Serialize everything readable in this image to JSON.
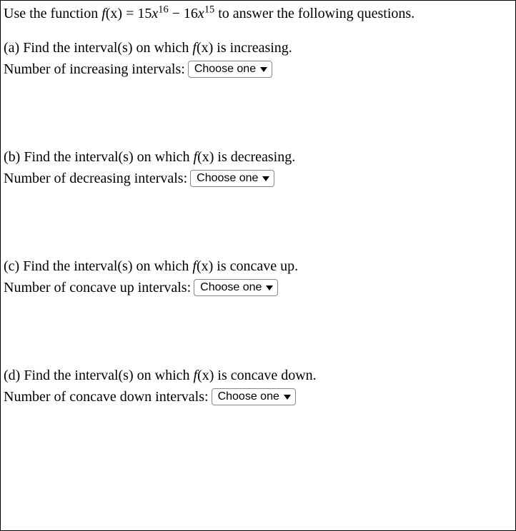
{
  "intro": {
    "prefix": "Use the function ",
    "func_lhs": "f",
    "func_arg": "(x) = 15",
    "var1": "x",
    "exp1": "16",
    "minus": " − 16",
    "var2": "x",
    "exp2": "15",
    "suffix": " to answer the following questions."
  },
  "questions": {
    "a": {
      "label": "(a) Find the interval(s) on which ",
      "func": "f",
      "arg": "(x)",
      "tail": " is increasing.",
      "answer_label": "Number of increasing intervals:",
      "dropdown": "Choose one"
    },
    "b": {
      "label": "(b) Find the interval(s) on which ",
      "func": "f",
      "arg": "(x)",
      "tail": " is decreasing.",
      "answer_label": "Number of decreasing intervals:",
      "dropdown": "Choose one"
    },
    "c": {
      "label": "(c) Find the interval(s) on which ",
      "func": "f",
      "arg": "(x)",
      "tail": " is concave up.",
      "answer_label": "Number of concave up intervals:",
      "dropdown": "Choose one"
    },
    "d": {
      "label": "(d) Find the interval(s) on which ",
      "func": "f",
      "arg": "(x)",
      "tail": " is concave down.",
      "answer_label": "Number of concave down intervals:",
      "dropdown": "Choose one"
    }
  }
}
